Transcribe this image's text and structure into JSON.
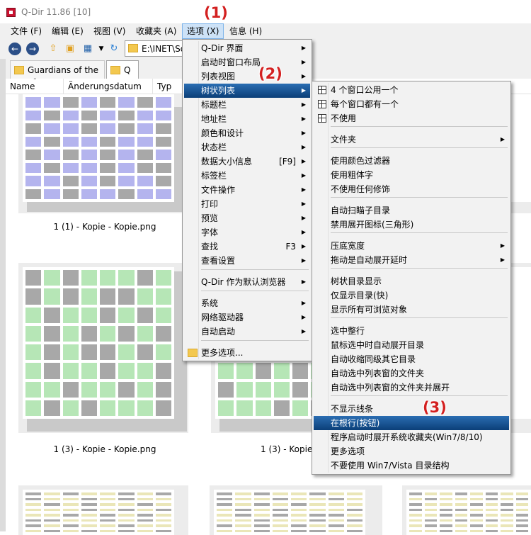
{
  "window": {
    "title": "Q-Dir 11.86 [10]"
  },
  "menubar": {
    "items": [
      "文件 (F)",
      "编辑 (E)",
      "视图 (V)",
      "收藏夹 (A)",
      "选项 (X)",
      "信息 (H)"
    ]
  },
  "toolbar": {
    "address": "E:\\INET\\So"
  },
  "tabs": [
    {
      "label": "Guardians of the "
    },
    {
      "label": "Q"
    }
  ],
  "columns": [
    "Name",
    "Änderungsdatum",
    "Typ"
  ],
  "thumbnails": [
    {
      "label": "1 (1) - Kopie - Kopie.png",
      "color": "#b4b4ee"
    },
    {
      "label": "1 (3) - Kopie - Kopie.png",
      "color": "#b6e6b6"
    },
    {
      "label": "1 (3) - Kopie",
      "color": "#b6e6b6"
    },
    {
      "label": "",
      "color": "#eae6b8"
    },
    {
      "label": "",
      "color": "#eae6b8"
    },
    {
      "label": "",
      "color": "#eae6b8"
    }
  ],
  "options_menu": {
    "items": [
      {
        "label": "Q-Dir 界面",
        "accel": "",
        "submenu": true
      },
      {
        "label": "启动时窗口布局",
        "accel": "",
        "submenu": true
      },
      {
        "label": "列表视图",
        "accel": "",
        "submenu": true
      },
      {
        "label": "树状列表",
        "accel": "",
        "submenu": true
      },
      {
        "label": "标题栏",
        "accel": "",
        "submenu": true
      },
      {
        "label": "地址栏",
        "accel": "",
        "submenu": true
      },
      {
        "label": "颜色和设计",
        "accel": "",
        "submenu": true
      },
      {
        "label": "状态栏",
        "accel": "",
        "submenu": true
      },
      {
        "label": "数据大小信息",
        "accel": "[F9]",
        "submenu": true
      },
      {
        "label": "标签栏",
        "accel": "",
        "submenu": true
      },
      {
        "label": "文件操作",
        "accel": "",
        "submenu": true
      },
      {
        "label": "打印",
        "accel": "",
        "submenu": true
      },
      {
        "label": "预览",
        "accel": "",
        "submenu": true
      },
      {
        "label": "字体",
        "accel": "",
        "submenu": true
      },
      {
        "label": "查找",
        "accel": "F3",
        "submenu": true
      },
      {
        "label": "查看设置",
        "accel": "",
        "submenu": true
      },
      {
        "label": "Q-Dir 作为默认浏览器",
        "accel": "",
        "submenu": true
      },
      {
        "label": "系统",
        "accel": "",
        "submenu": true
      },
      {
        "label": "网络驱动器",
        "accel": "",
        "submenu": true
      },
      {
        "label": "自动启动",
        "accel": "",
        "submenu": true
      },
      {
        "label": "更多选项...",
        "accel": "",
        "submenu": false
      }
    ]
  },
  "tree_menu": {
    "items": [
      {
        "label": "4 个窗口公用一个",
        "submenu": false
      },
      {
        "label": "每个窗口都有一个",
        "submenu": false
      },
      {
        "label": "不使用",
        "submenu": false
      },
      {
        "label": "文件夹",
        "submenu": true
      },
      {
        "label": "使用颜色过滤器",
        "submenu": false
      },
      {
        "label": "使用粗体字",
        "submenu": false
      },
      {
        "label": "不使用任何修饰",
        "submenu": false
      },
      {
        "label": "自动扫瞄子目录",
        "submenu": false
      },
      {
        "label": "禁用展开图标(三角形)",
        "submenu": false
      },
      {
        "label": "压底宽度",
        "submenu": true
      },
      {
        "label": "拖动是自动展开延时",
        "submenu": true
      },
      {
        "label": "树状目录显示",
        "submenu": false
      },
      {
        "label": "仅显示目录(快)",
        "submenu": false
      },
      {
        "label": "显示所有可浏览对象",
        "submenu": false
      },
      {
        "label": "选中整行",
        "submenu": false
      },
      {
        "label": "鼠标选中时自动展开目录",
        "submenu": false
      },
      {
        "label": "自动收缩同级其它目录",
        "submenu": false
      },
      {
        "label": "自动选中列表窗的文件夹",
        "submenu": false
      },
      {
        "label": "自动选中列表窗的文件夹并展开",
        "submenu": false
      },
      {
        "label": "不显示线条",
        "submenu": false
      },
      {
        "label": "在根行(按钮)",
        "submenu": false
      },
      {
        "label": "程序启动时展开系统收藏夹(Win7/8/10)",
        "submenu": false
      },
      {
        "label": "更多选项",
        "submenu": false
      },
      {
        "label": "不要使用 Win7/Vista 目录结构",
        "submenu": false
      }
    ]
  },
  "callouts": [
    "(1)",
    "(2)",
    "(3)"
  ],
  "colors": {
    "menu_highlight": "#0d4d8f",
    "callout": "#d32020"
  }
}
